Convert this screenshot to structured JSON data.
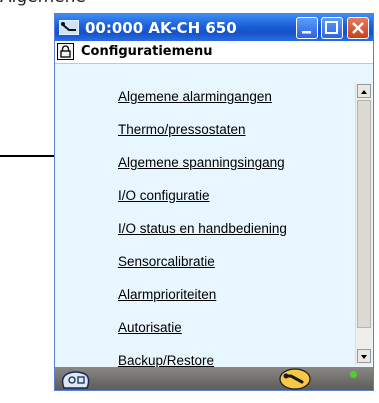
{
  "window": {
    "title": "00:000 AK-CH 650"
  },
  "menubar": {
    "label": "Configuratiemenu"
  },
  "menu": {
    "items": [
      "Algemene alarmingangen",
      "Thermo/pressostaten",
      "Algemene spanningsingang",
      "I/O configuratie",
      "I/O status en handbediening",
      "Sensorcalibratie",
      "Alarmprioriteiten",
      "Autorisatie",
      "Backup/Restore"
    ]
  },
  "icons": {
    "title": "tool-icon",
    "menubar": "lock-icon",
    "status_left": "controller-icon",
    "status_right": "wrench-icon",
    "status_dot": "green-led-icon"
  },
  "colors": {
    "titlebar": "#1b5fd9",
    "window_bg": "#e8f6ff",
    "status_bar": "#6c6a66",
    "led": "#4fd12c"
  }
}
